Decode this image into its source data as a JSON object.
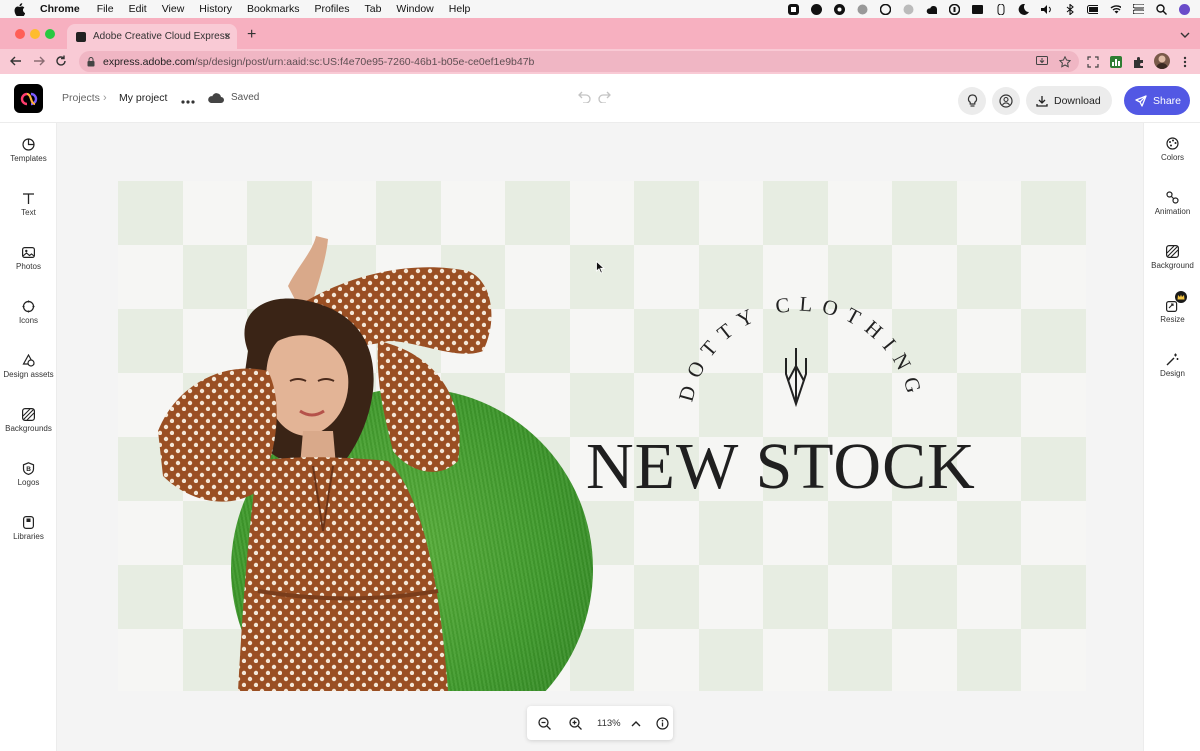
{
  "menubar": {
    "app_name": "Chrome",
    "items": [
      "File",
      "Edit",
      "View",
      "History",
      "Bookmarks",
      "Profiles",
      "Tab",
      "Window",
      "Help"
    ]
  },
  "browser": {
    "tab_title": "Adobe Creative Cloud Express",
    "url_host": "express.adobe.com",
    "url_path": "/sp/design/post/urn:aaid:sc:US:f4e70e95-7260-46b1-b05e-ce0ef1e9b47b"
  },
  "header": {
    "breadcrumb_projects": "Projects",
    "project_name": "My project",
    "saved_status": "Saved",
    "download_label": "Download",
    "share_label": "Share"
  },
  "left_rail": [
    {
      "label": "Templates",
      "icon": "templates-icon"
    },
    {
      "label": "Text",
      "icon": "text-icon"
    },
    {
      "label": "Photos",
      "icon": "photos-icon"
    },
    {
      "label": "Icons",
      "icon": "icons-icon"
    },
    {
      "label": "Design assets",
      "icon": "design-assets-icon"
    },
    {
      "label": "Backgrounds",
      "icon": "backgrounds-icon"
    },
    {
      "label": "Logos",
      "icon": "logos-icon"
    },
    {
      "label": "Libraries",
      "icon": "libraries-icon"
    }
  ],
  "right_rail": [
    {
      "label": "Colors",
      "icon": "colors-icon"
    },
    {
      "label": "Animation",
      "icon": "animation-icon"
    },
    {
      "label": "Background",
      "icon": "background-icon"
    },
    {
      "label": "Resize",
      "icon": "resize-icon"
    },
    {
      "label": "Design",
      "icon": "design-icon"
    }
  ],
  "canvas": {
    "brand_text": "DOTTY CLOTHING",
    "headline": "NEW STOCK",
    "check_color": "#e7ede2",
    "grass_color": "#45a02f"
  },
  "zoom": {
    "level": "113%"
  },
  "colors": {
    "tab_strip": "#f7b0c0",
    "share_button": "#5258e4"
  }
}
